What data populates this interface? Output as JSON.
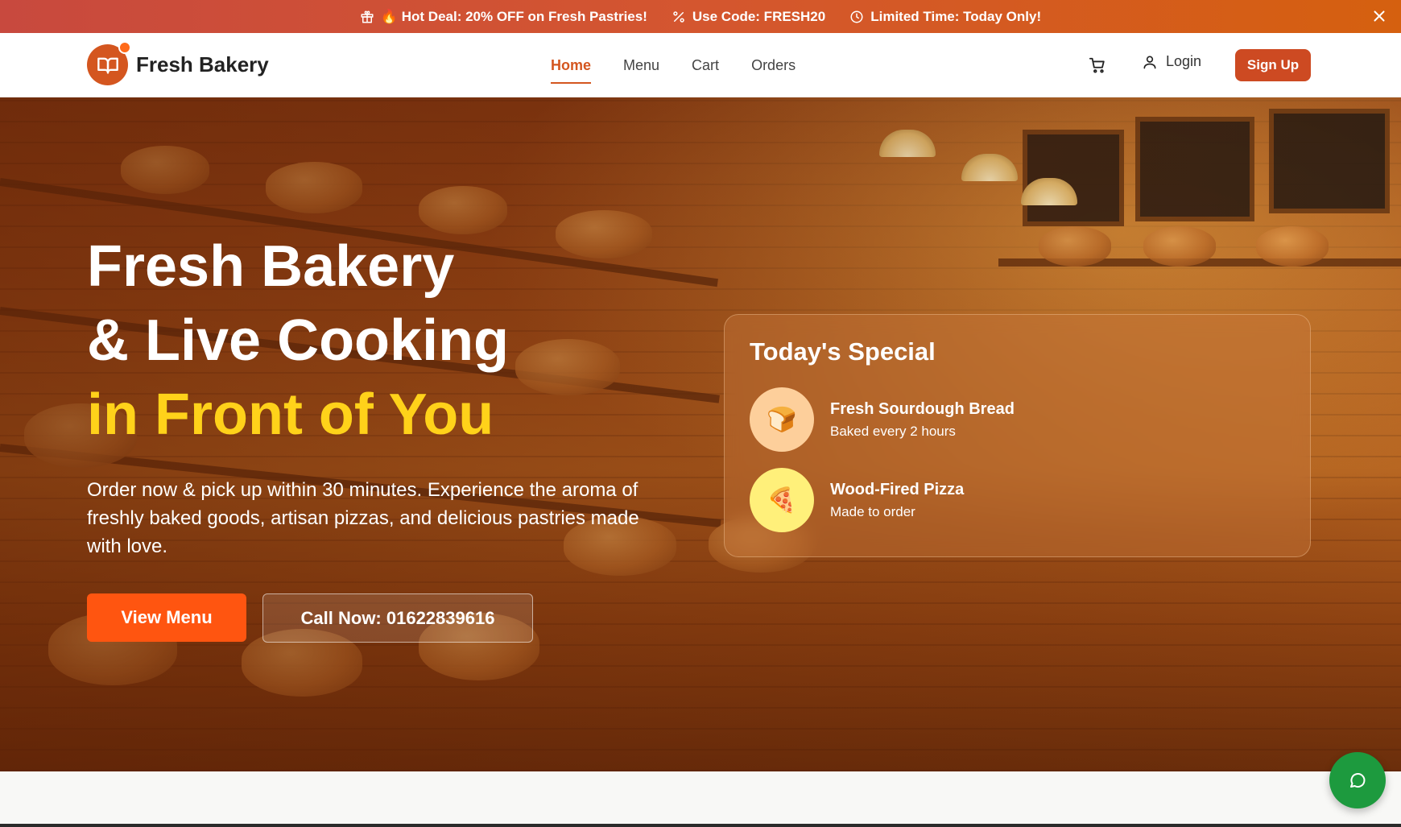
{
  "promo": {
    "items": [
      {
        "icon": "gift-icon",
        "text": "🔥 Hot Deal: 20% OFF on Fresh Pastries!"
      },
      {
        "icon": "percent-icon",
        "text": "Use Code: FRESH20"
      },
      {
        "icon": "clock-icon",
        "text": "Limited Time: Today Only!"
      }
    ],
    "close_icon": "close-icon"
  },
  "header": {
    "logo_text": "Fresh Bakery",
    "logo_icon": "book-open-icon",
    "nav": [
      {
        "label": "Home",
        "active": true
      },
      {
        "label": "Menu",
        "active": false
      },
      {
        "label": "Cart",
        "active": false
      },
      {
        "label": "Orders",
        "active": false
      }
    ],
    "cart_icon": "shopping-cart-icon",
    "login_label": "Login",
    "signup_label": "Sign Up"
  },
  "hero": {
    "title_line1": "Fresh Bakery",
    "title_line2": "& Live Cooking",
    "title_line3": "in Front of You",
    "description": "Order now & pick up within 30 minutes. Experience the aroma of freshly baked goods, artisan pizzas, and delicious pastries made with love.",
    "primary_button": "View Menu",
    "secondary_button": "Call Now: 01622839616"
  },
  "special": {
    "title": "Today's Special",
    "items": [
      {
        "icon": "🍞",
        "name": "Fresh Sourdough Bread",
        "subtitle": "Baked every 2 hours"
      },
      {
        "icon": "🍕",
        "name": "Wood-Fired Pizza",
        "subtitle": "Made to order"
      }
    ]
  },
  "colors": {
    "accent": "#d4561f",
    "cta": "#ff5510",
    "highlight": "#ffd21a",
    "chat": "#1d9a3e"
  },
  "chat": {
    "icon": "message-circle-icon"
  }
}
